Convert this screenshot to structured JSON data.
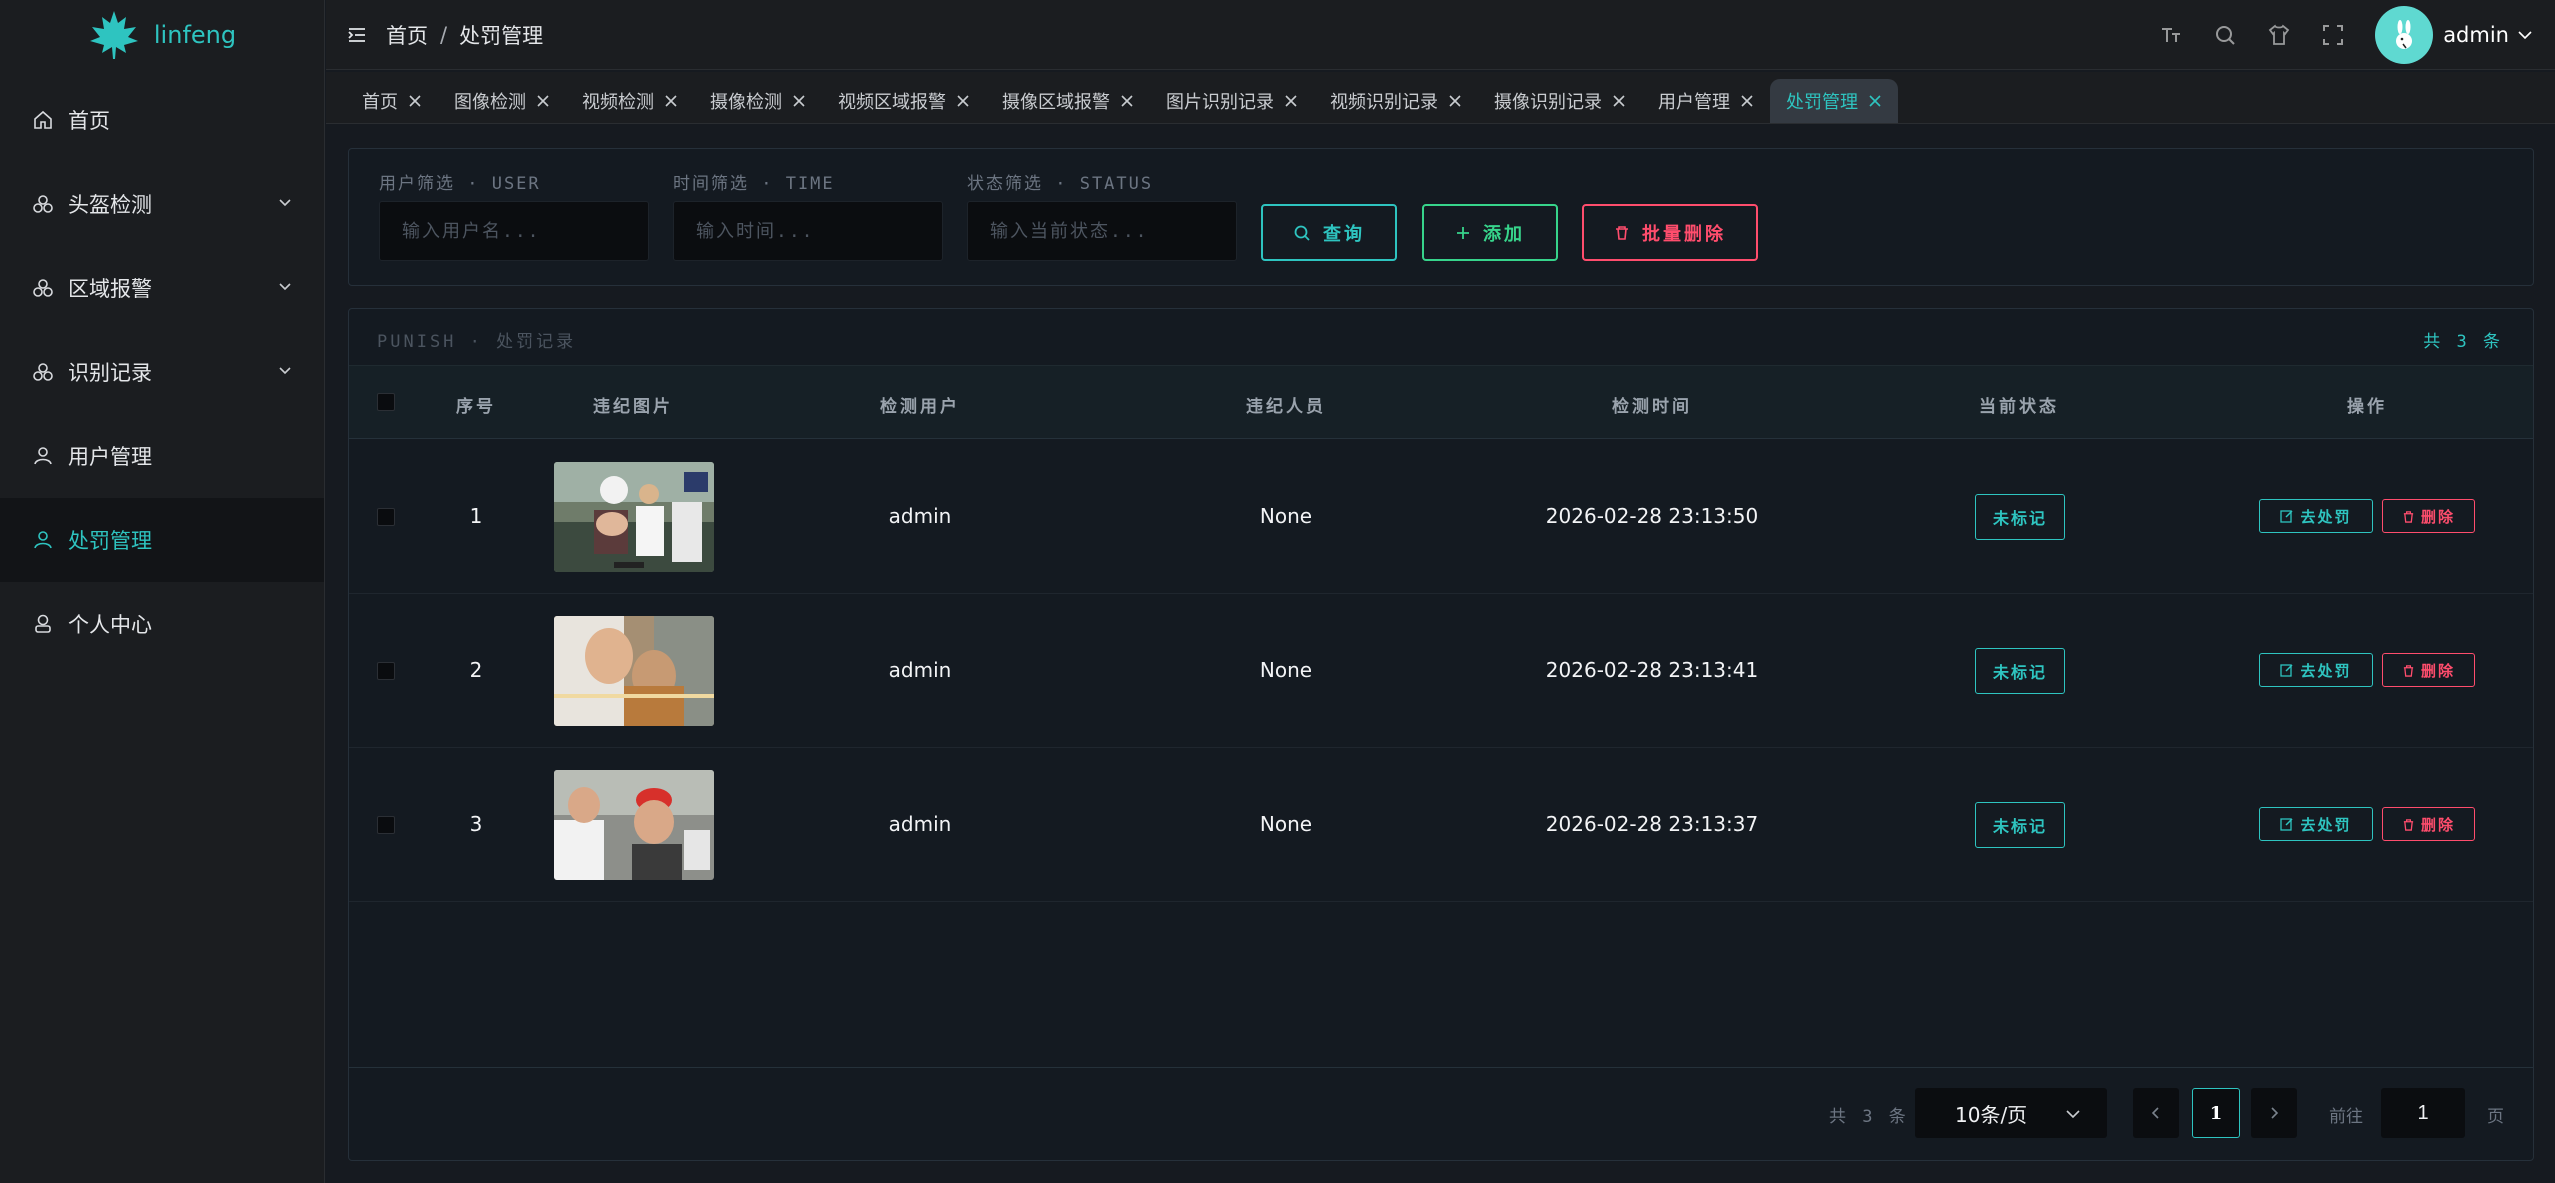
{
  "app": {
    "name": "linfeng"
  },
  "sidebar": {
    "items": [
      {
        "label": "首页",
        "icon": "home-icon",
        "expandable": false,
        "active": false
      },
      {
        "label": "头盔检测",
        "icon": "cluster-icon",
        "expandable": true,
        "active": false
      },
      {
        "label": "区域报警",
        "icon": "cluster-icon",
        "expandable": true,
        "active": false
      },
      {
        "label": "识别记录",
        "icon": "cluster-icon",
        "expandable": true,
        "active": false
      },
      {
        "label": "用户管理",
        "icon": "user-icon",
        "expandable": false,
        "active": false
      },
      {
        "label": "处罚管理",
        "icon": "user-icon",
        "expandable": false,
        "active": true
      },
      {
        "label": "个人中心",
        "icon": "person-icon",
        "expandable": false,
        "active": false
      }
    ]
  },
  "header": {
    "breadcrumb": [
      "首页",
      "处罚管理"
    ],
    "breadcrumb_separator": "/",
    "user": {
      "name": "admin"
    }
  },
  "tabs": [
    {
      "label": "首页",
      "active": false
    },
    {
      "label": "图像检测",
      "active": false
    },
    {
      "label": "视频检测",
      "active": false
    },
    {
      "label": "摄像检测",
      "active": false
    },
    {
      "label": "视频区域报警",
      "active": false
    },
    {
      "label": "摄像区域报警",
      "active": false
    },
    {
      "label": "图片识别记录",
      "active": false
    },
    {
      "label": "视频识别记录",
      "active": false
    },
    {
      "label": "摄像识别记录",
      "active": false
    },
    {
      "label": "用户管理",
      "active": false
    },
    {
      "label": "处罚管理",
      "active": true
    }
  ],
  "filters": {
    "user": {
      "label": "用户筛选 · USER",
      "placeholder": "输入用户名...",
      "value": ""
    },
    "time": {
      "label": "时间筛选 · TIME",
      "placeholder": "输入时间...",
      "value": ""
    },
    "status": {
      "label": "状态筛选 · STATUS",
      "placeholder": "输入当前状态...",
      "value": ""
    },
    "query_label": "查询",
    "add_label": "添加",
    "bulk_delete_label": "批量删除"
  },
  "table": {
    "title": "PUNISH · 处罚记录",
    "count_text": "共 3 条",
    "columns": [
      "序号",
      "违纪图片",
      "检测用户",
      "违纪人员",
      "检测时间",
      "当前状态",
      "操作"
    ],
    "rows": [
      {
        "index": "1",
        "user": "admin",
        "person": "None",
        "time": "2026-02-28 23:13:50",
        "status": "未标记",
        "action_handle": "去处罚",
        "action_delete": "删除"
      },
      {
        "index": "2",
        "user": "admin",
        "person": "None",
        "time": "2026-02-28 23:13:41",
        "status": "未标记",
        "action_handle": "去处罚",
        "action_delete": "删除"
      },
      {
        "index": "3",
        "user": "admin",
        "person": "None",
        "time": "2026-02-28 23:13:37",
        "status": "未标记",
        "action_handle": "去处罚",
        "action_delete": "删除"
      }
    ]
  },
  "pagination": {
    "total_text": "共 3 条",
    "page_size": "10条/页",
    "current_page": "1",
    "goto_label": "前往",
    "goto_value": "1",
    "goto_unit": "页"
  },
  "colors": {
    "accent": "#2ec4c0",
    "success": "#37d48b",
    "danger": "#ff4d6d",
    "background": "#161a20",
    "sidebar": "#1b1d20"
  }
}
